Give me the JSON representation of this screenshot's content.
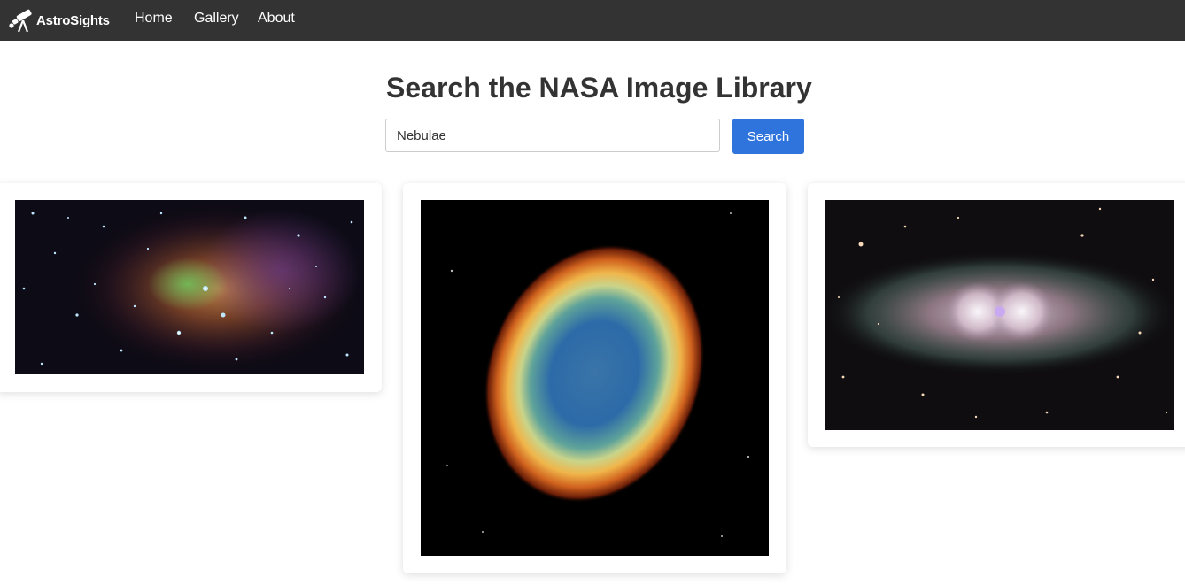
{
  "navbar": {
    "brand": "AstroSights",
    "links": [
      {
        "label": "Home"
      },
      {
        "label": "Gallery"
      },
      {
        "label": "About"
      }
    ]
  },
  "page": {
    "title": "Search the NASA Image Library"
  },
  "search": {
    "value": "Nebulae",
    "button_label": "Search"
  },
  "results": [
    {
      "icon": "spitzer-nebula-image"
    },
    {
      "icon": "ring-nebula-image"
    },
    {
      "icon": "ant-nebula-image"
    }
  ],
  "colors": {
    "navbar_bg": "#333333",
    "accent": "#2f74dc"
  }
}
